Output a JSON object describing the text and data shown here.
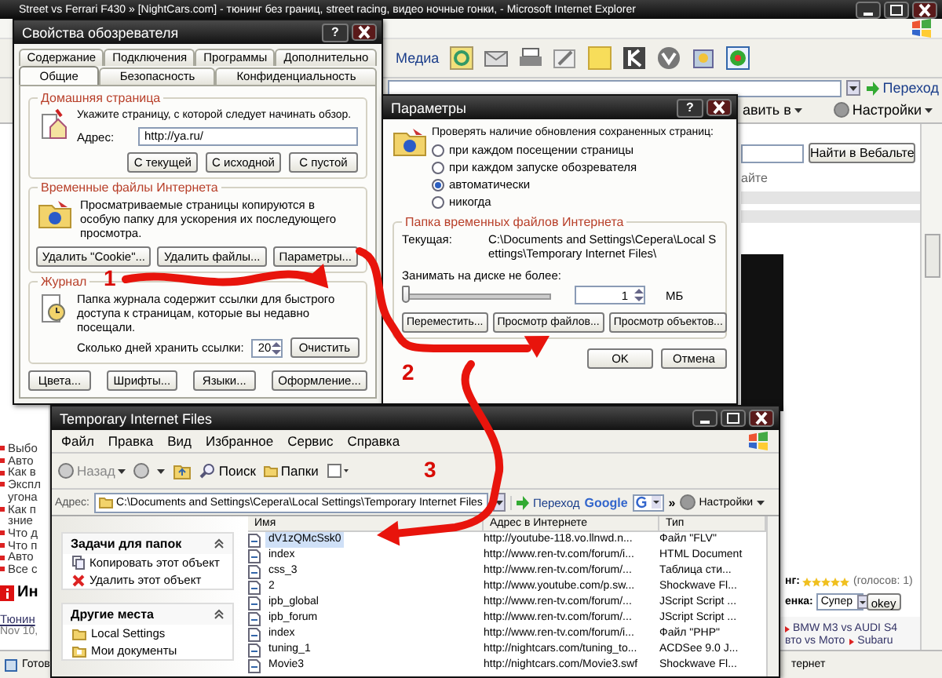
{
  "browser": {
    "title": "Street vs Ferrari F430 » [NightCars.com] - тюнинг без границ, street racing, видео ночные гонки, - Microsoft Internet Explorer",
    "toolbar": {
      "media": "Медиа"
    },
    "address_bar": {
      "go_button": "Переход"
    },
    "links_bar": {
      "add_menu": "авить в",
      "settings_menu": "Настройки"
    },
    "page": {
      "search_button": "Найти в Вебальте",
      "search_hint": "айте",
      "left_list": [
        {
          "text": "Выбо",
          "kind": "bullet"
        },
        {
          "text": "Авто",
          "kind": "bullet"
        },
        {
          "text": "Как в",
          "kind": "bullet"
        },
        {
          "text": "Экспл",
          "kind": "bullet"
        },
        {
          "text": "угона",
          "kind": "plain"
        },
        {
          "text": "Как п",
          "kind": "bullet"
        },
        {
          "text": "зние",
          "kind": "plain"
        },
        {
          "text": "Что д",
          "kind": "bullet"
        },
        {
          "text": "Что п",
          "kind": "bullet"
        },
        {
          "text": "Авто",
          "kind": "bullet"
        },
        {
          "text": "Все с",
          "kind": "bullet"
        }
      ],
      "section_title": "Ин",
      "news_title": "Тюнин",
      "news_date": "Nov 10,",
      "rating_label": "нг:",
      "stars": 5,
      "votes": "(голосов: 1)",
      "grade_label": "енка:",
      "grade_select": "Супер",
      "grade_button": "okey",
      "links": [
        {
          "text": "BMW M3 vs AUDI S4",
          "kind": "bullet"
        },
        {
          "text": "вто vs Мото",
          "kind": "plain"
        },
        {
          "text": "Subaru",
          "kind": "bullet"
        }
      ]
    },
    "status_bar": {
      "text": "Готов",
      "zone": "тернет"
    }
  },
  "internet_options": {
    "title": "Свойства обозревателя",
    "help_button": "?",
    "tab_rows": [
      [
        {
          "label": "Содержание",
          "selected": false
        },
        {
          "label": "Подключения",
          "selected": false
        },
        {
          "label": "Программы",
          "selected": false
        },
        {
          "label": "Дополнительно",
          "selected": false
        }
      ],
      [
        {
          "label": "Общие",
          "selected": true
        },
        {
          "label": "Безопасность",
          "selected": false
        },
        {
          "label": "Конфиденциальность",
          "selected": false
        }
      ]
    ],
    "home_page": {
      "title": "Домашняя страница",
      "hint": "Укажите страницу, с которой следует начинать обзор.",
      "address_label": "Адрес:",
      "address": "http://ya.ru/",
      "buttons": [
        "С текущей",
        "С исходной",
        "С пустой"
      ]
    },
    "temp_files": {
      "title": "Временные файлы Интернета",
      "text": "Просматриваемые страницы копируются в особую папку для ускорения их последующего просмотра.",
      "buttons": [
        "Удалить \"Cookie\"...",
        "Удалить файлы...",
        "Параметры..."
      ]
    },
    "history": {
      "title": "Журнал",
      "text": "Папка журнала содержит ссылки для быстрого доступа к страницам, которые вы недавно посещали.",
      "days_label": "Сколько дней хранить ссылки:",
      "days": "20",
      "clear_button": "Очистить"
    },
    "buttons": [
      "Цвета...",
      "Шрифты...",
      "Языки...",
      "Оформление..."
    ]
  },
  "settings_dialog": {
    "title": "Параметры",
    "help_button": "?",
    "check_label": "Проверять наличие обновления сохраненных страниц:",
    "check_options": [
      {
        "label": "при каждом посещении страницы",
        "selected": false
      },
      {
        "label": "при каждом запуске обозревателя",
        "selected": false
      },
      {
        "label": "автоматически",
        "selected": true
      },
      {
        "label": "никогда",
        "selected": false
      }
    ],
    "folder": {
      "title": "Папка временных файлов Интернета",
      "current_label": "Текущая:",
      "current_path": "C:\\Documents and Settings\\Cepera\\Local Settings\\Temporary Internet Files\\",
      "limit_label": "Занимать на диске не более:",
      "level": 0,
      "size": "1",
      "unit": "МБ",
      "buttons": [
        "Переместить...",
        "Просмотр файлов...",
        "Просмотр объектов..."
      ]
    },
    "buttons": [
      "OK",
      "Отмена"
    ]
  },
  "explorer": {
    "title": "Temporary Internet Files",
    "menu": [
      "Файл",
      "Правка",
      "Вид",
      "Избранное",
      "Сервис",
      "Справка"
    ],
    "toolbar": {
      "back": "Назад",
      "search": "Поиск",
      "folders": "Папки"
    },
    "address_label": "Адрес:",
    "address": "C:\\Documents and Settings\\Cepera\\Local Settings\\Temporary Internet Files",
    "go_button": "Переход",
    "google": "Google",
    "chevron": "»",
    "settings_menu": "Настройки",
    "tasks": {
      "title": "Задачи для папок",
      "items": [
        "Копировать этот объект",
        "Удалить этот объект"
      ]
    },
    "places": {
      "title": "Другие места",
      "items": [
        "Local Settings",
        "Мои документы"
      ]
    },
    "columns": [
      "Имя",
      "Адрес в Интернете",
      "Тип"
    ],
    "rows": [
      {
        "name": "dV1zQMcSsk0",
        "address": "http://youtube-118.vo.llnwd.n...",
        "type": "Файл \"FLV\"",
        "selected": true
      },
      {
        "name": "index",
        "address": "http://www.ren-tv.com/forum/i...",
        "type": "HTML Document",
        "selected": false
      },
      {
        "name": "css_3",
        "address": "http://www.ren-tv.com/forum/...",
        "type": "Таблица сти...",
        "selected": false
      },
      {
        "name": "2",
        "address": "http://www.youtube.com/p.sw...",
        "type": "Shockwave Fl...",
        "selected": false
      },
      {
        "name": "ipb_global",
        "address": "http://www.ren-tv.com/forum/...",
        "type": "JScript Script ...",
        "selected": false
      },
      {
        "name": "ipb_forum",
        "address": "http://www.ren-tv.com/forum/...",
        "type": "JScript Script ...",
        "selected": false
      },
      {
        "name": "index",
        "address": "http://www.ren-tv.com/forum/i...",
        "type": "Файл \"PHP\"",
        "selected": false
      },
      {
        "name": "tuning_1",
        "address": "http://nightcars.com/tuning_to...",
        "type": "ACDSee 9.0 J...",
        "selected": false
      },
      {
        "name": "Movie3",
        "address": "http://nightcars.com/Movie3.swf",
        "type": "Shockwave Fl...",
        "selected": false
      }
    ]
  },
  "annotations": [
    "1",
    "2",
    "3"
  ]
}
